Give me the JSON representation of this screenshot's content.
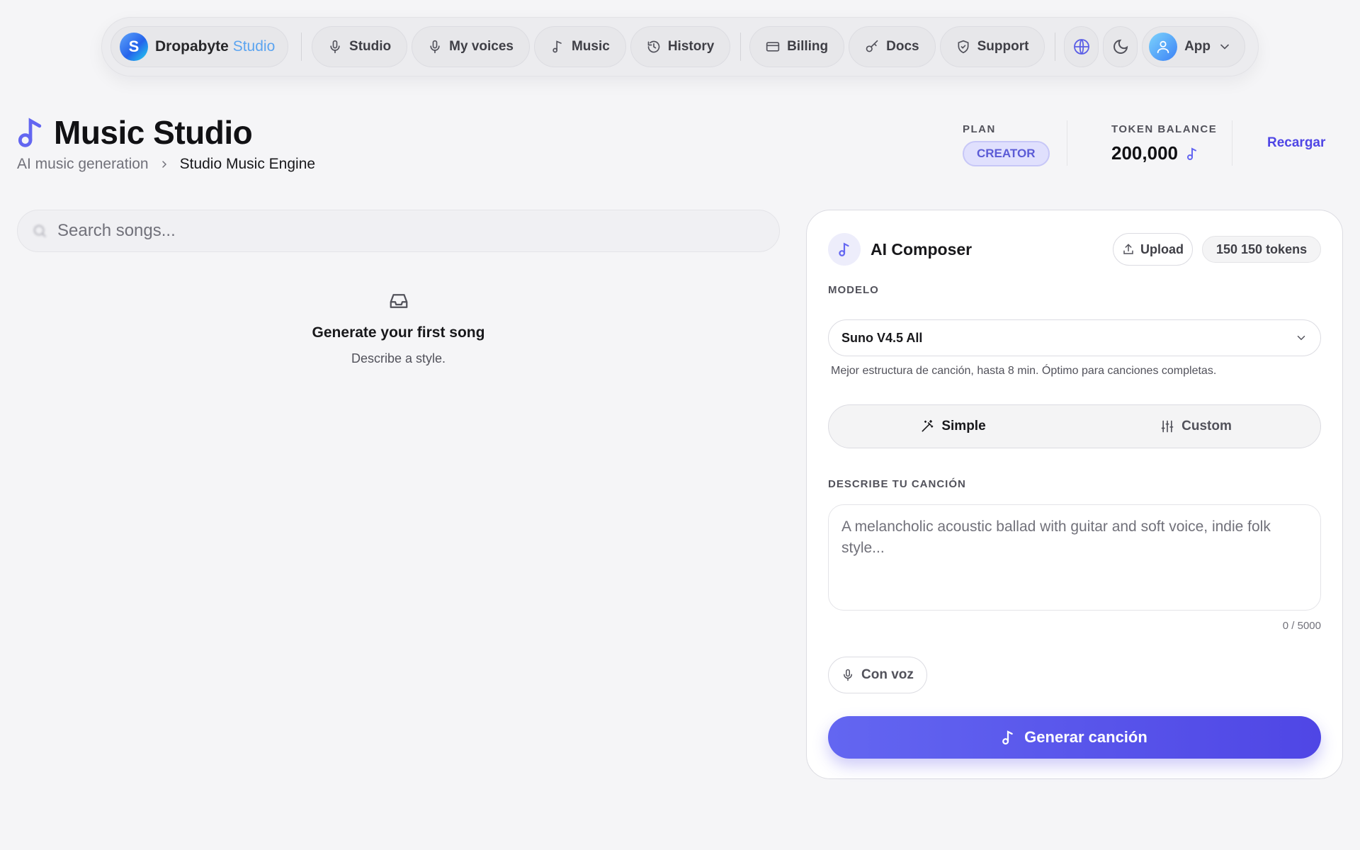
{
  "nav": {
    "brand_name": "Dropabyte",
    "brand_accent": "Studio",
    "brand_letter": "S",
    "items": [
      {
        "label": "Studio",
        "icon": "mic-icon"
      },
      {
        "label": "My voices",
        "icon": "mic-icon"
      },
      {
        "label": "Music",
        "icon": "music-note-icon"
      },
      {
        "label": "History",
        "icon": "history-icon"
      },
      {
        "label": "Billing",
        "icon": "credit-card-icon"
      },
      {
        "label": "Docs",
        "icon": "key-icon"
      },
      {
        "label": "Support",
        "icon": "shield-icon"
      }
    ],
    "user_label": "App"
  },
  "header": {
    "title": "Music Studio",
    "breadcrumb": [
      "AI music generation",
      "Studio Music Engine"
    ],
    "plan_label": "PLAN",
    "plan_value": "CREATOR",
    "token_label": "TOKEN BALANCE",
    "token_value": "200,000",
    "recharge_label": "Recargar"
  },
  "library": {
    "search_placeholder": "Search songs...",
    "empty_title": "Generate your first song",
    "empty_subtitle": "Describe a style."
  },
  "composer": {
    "title": "AI Composer",
    "upload_label": "Upload",
    "token_cost": "150 150 tokens",
    "model_label": "MODELO",
    "model_value": "Suno V4.5 All",
    "model_description": "Mejor estructura de canción, hasta 8 min. Óptimo para canciones completas.",
    "modes": [
      "Simple",
      "Custom"
    ],
    "active_mode": "Simple",
    "describe_label": "DESCRIBE TU CANCIÓN",
    "describe_placeholder": "A melancholic acoustic ballad with guitar and soft voice, indie folk style...",
    "describe_value": "",
    "char_count": "0 / 5000",
    "voice_label": "Con voz",
    "generate_label": "Generar canción"
  },
  "colors": {
    "accent": "#6366f1",
    "accent_dark": "#4f46e5",
    "background": "#f5f5f7"
  }
}
